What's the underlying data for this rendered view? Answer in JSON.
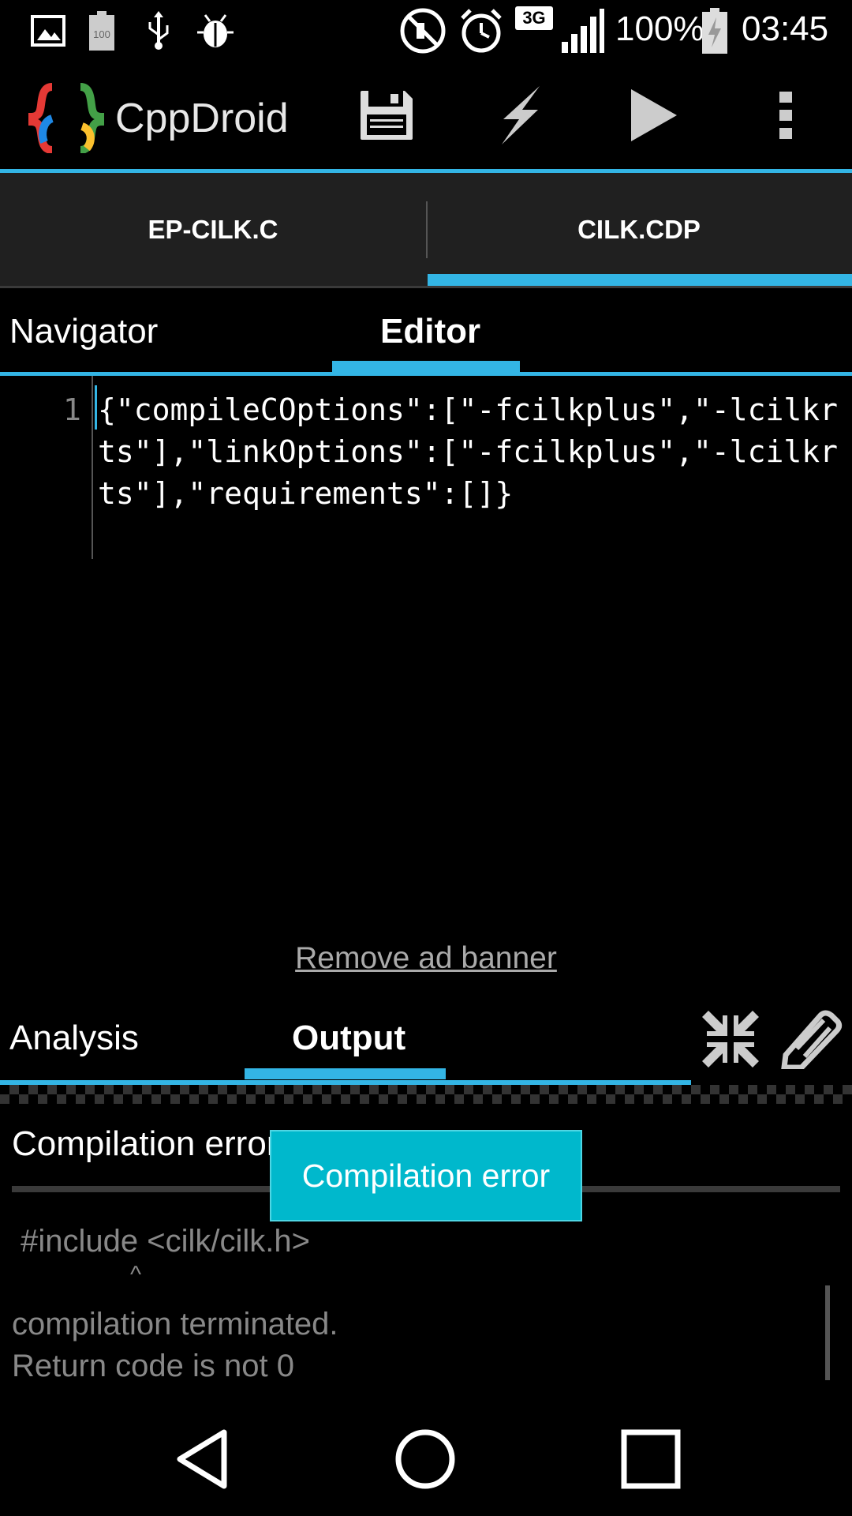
{
  "status_bar": {
    "battery_percent": "100%",
    "time": "03:45",
    "network_type": "3G",
    "battery_icon_label": "100",
    "icons": [
      "gallery-icon",
      "battery-100-icon",
      "usb-icon",
      "debug-bug-icon",
      "mute-icon",
      "alarm-icon",
      "network-3g-icon",
      "signal-icon",
      "battery-charging-icon"
    ]
  },
  "action_bar": {
    "title": "CppDroid",
    "actions": [
      "save-icon",
      "build-lightning-icon",
      "run-play-icon",
      "overflow-menu-icon"
    ]
  },
  "file_tabs": [
    {
      "label": "EP-CILK.C",
      "selected": false
    },
    {
      "label": "CILK.CDP",
      "selected": true
    }
  ],
  "sub_tabs": [
    {
      "label": "Navigator",
      "selected": false
    },
    {
      "label": "Editor",
      "selected": true
    }
  ],
  "editor": {
    "line_number": "1",
    "code": "{\"compileCOptions\":[\"-fcilkplus\",\"-lcilkrts\"],\"linkOptions\":[\"-fcilkplus\",\"-lcilkrts\"],\"requirements\":[]}"
  },
  "ad": {
    "remove_label": "Remove ad banner"
  },
  "panel_tabs": [
    {
      "label": "Analysis",
      "selected": false
    },
    {
      "label": "Output",
      "selected": true
    }
  ],
  "panel_actions": [
    "collapse-arrows-icon",
    "edit-pencil-icon"
  ],
  "output": {
    "title": "Compilation error",
    "lines": [
      " #include <cilk/cilk.h>",
      "                  ^",
      "compilation terminated.",
      "Return code is not 0"
    ]
  },
  "toast": {
    "text": "Compilation error"
  },
  "nav_bar": [
    "back-icon",
    "home-icon",
    "recents-icon"
  ],
  "colors": {
    "accent": "#33b5e5",
    "toast": "#00b8cc",
    "tab_bg": "#202020"
  }
}
